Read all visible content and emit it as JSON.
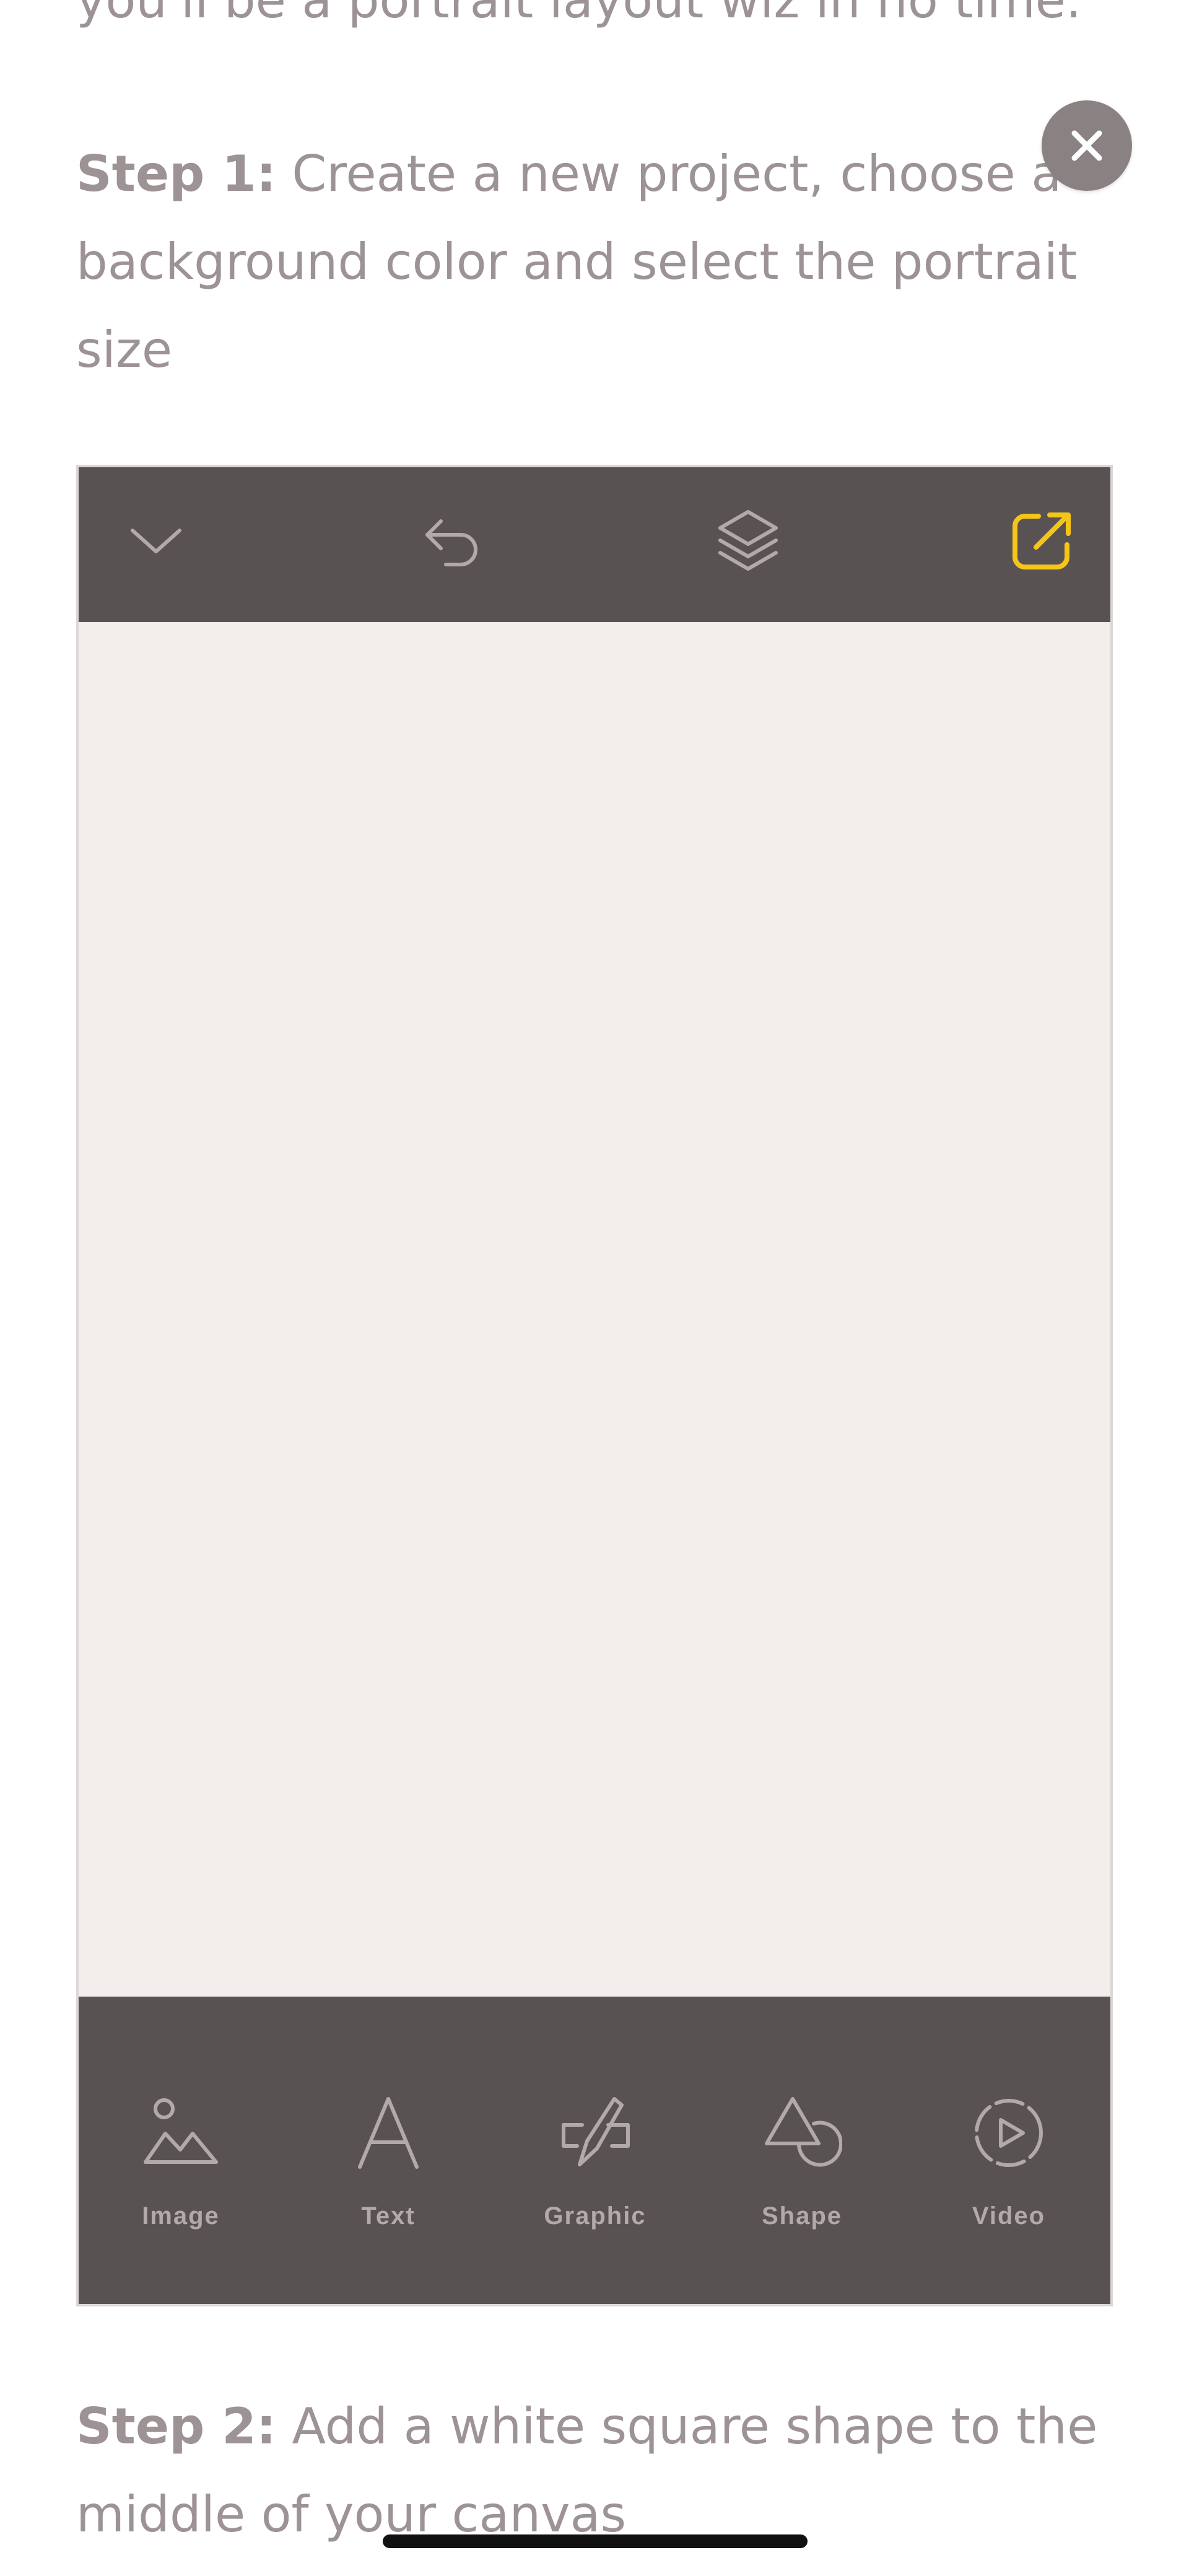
{
  "intro": {
    "text": "you'll be a portrait layout wiz in no time."
  },
  "step1": {
    "label": "Step 1:",
    "text": " Create a new project, choose a background color and select the portrait size"
  },
  "step2": {
    "label": "Step 2:",
    "text": " Add a white square shape to the middle of your canvas"
  },
  "close_button": {
    "icon": "close-icon"
  },
  "editor": {
    "top_icons": [
      "chevron-down-icon",
      "undo-icon",
      "layers-icon",
      "export-icon"
    ],
    "tools": [
      {
        "label": "Image",
        "icon": "image-icon"
      },
      {
        "label": "Text",
        "icon": "text-icon"
      },
      {
        "label": "Graphic",
        "icon": "graphic-icon"
      },
      {
        "label": "Shape",
        "icon": "shape-icon"
      },
      {
        "label": "Video",
        "icon": "video-icon"
      }
    ]
  },
  "colors": {
    "text": "#9d9394",
    "toolbar": "#595253",
    "canvas": "#f2eeec",
    "accent": "#f5c518",
    "icon": "#b2a9aa"
  }
}
